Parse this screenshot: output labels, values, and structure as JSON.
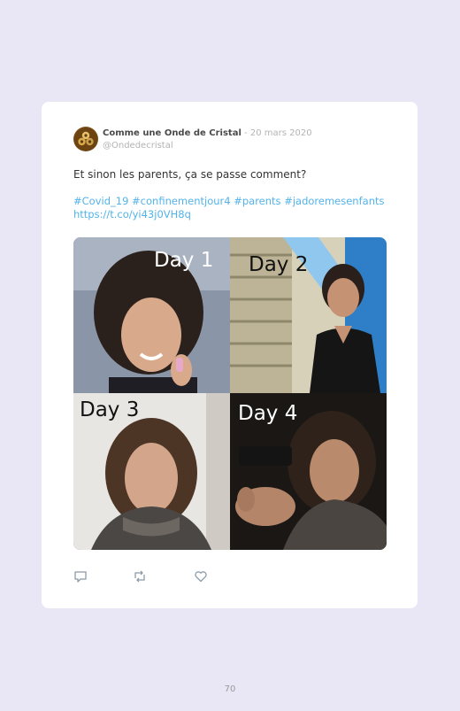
{
  "tweet": {
    "author_name": "Comme une Onde de Cristal",
    "separator": " - ",
    "date": "20 mars 2020",
    "handle": "@Ondedecristal",
    "text": "Et sinon les parents, ça se passe comment?",
    "hashtags": "#Covid_19 #confinementjour4 #parents #jadoremesenfants",
    "link": "https://t.co/yi43j0VH8q"
  },
  "photo": {
    "panels": [
      {
        "label": "Day 1"
      },
      {
        "label": "Day 2"
      },
      {
        "label": "Day 3"
      },
      {
        "label": "Day 4"
      }
    ]
  },
  "actions": {
    "reply_icon": "reply-icon",
    "retweet_icon": "retweet-icon",
    "like_icon": "heart-icon"
  },
  "page": {
    "number": "70"
  },
  "colors": {
    "background": "#e9e6f6",
    "card": "#ffffff",
    "link": "#52b3ea",
    "muted": "#b3b3b3"
  }
}
